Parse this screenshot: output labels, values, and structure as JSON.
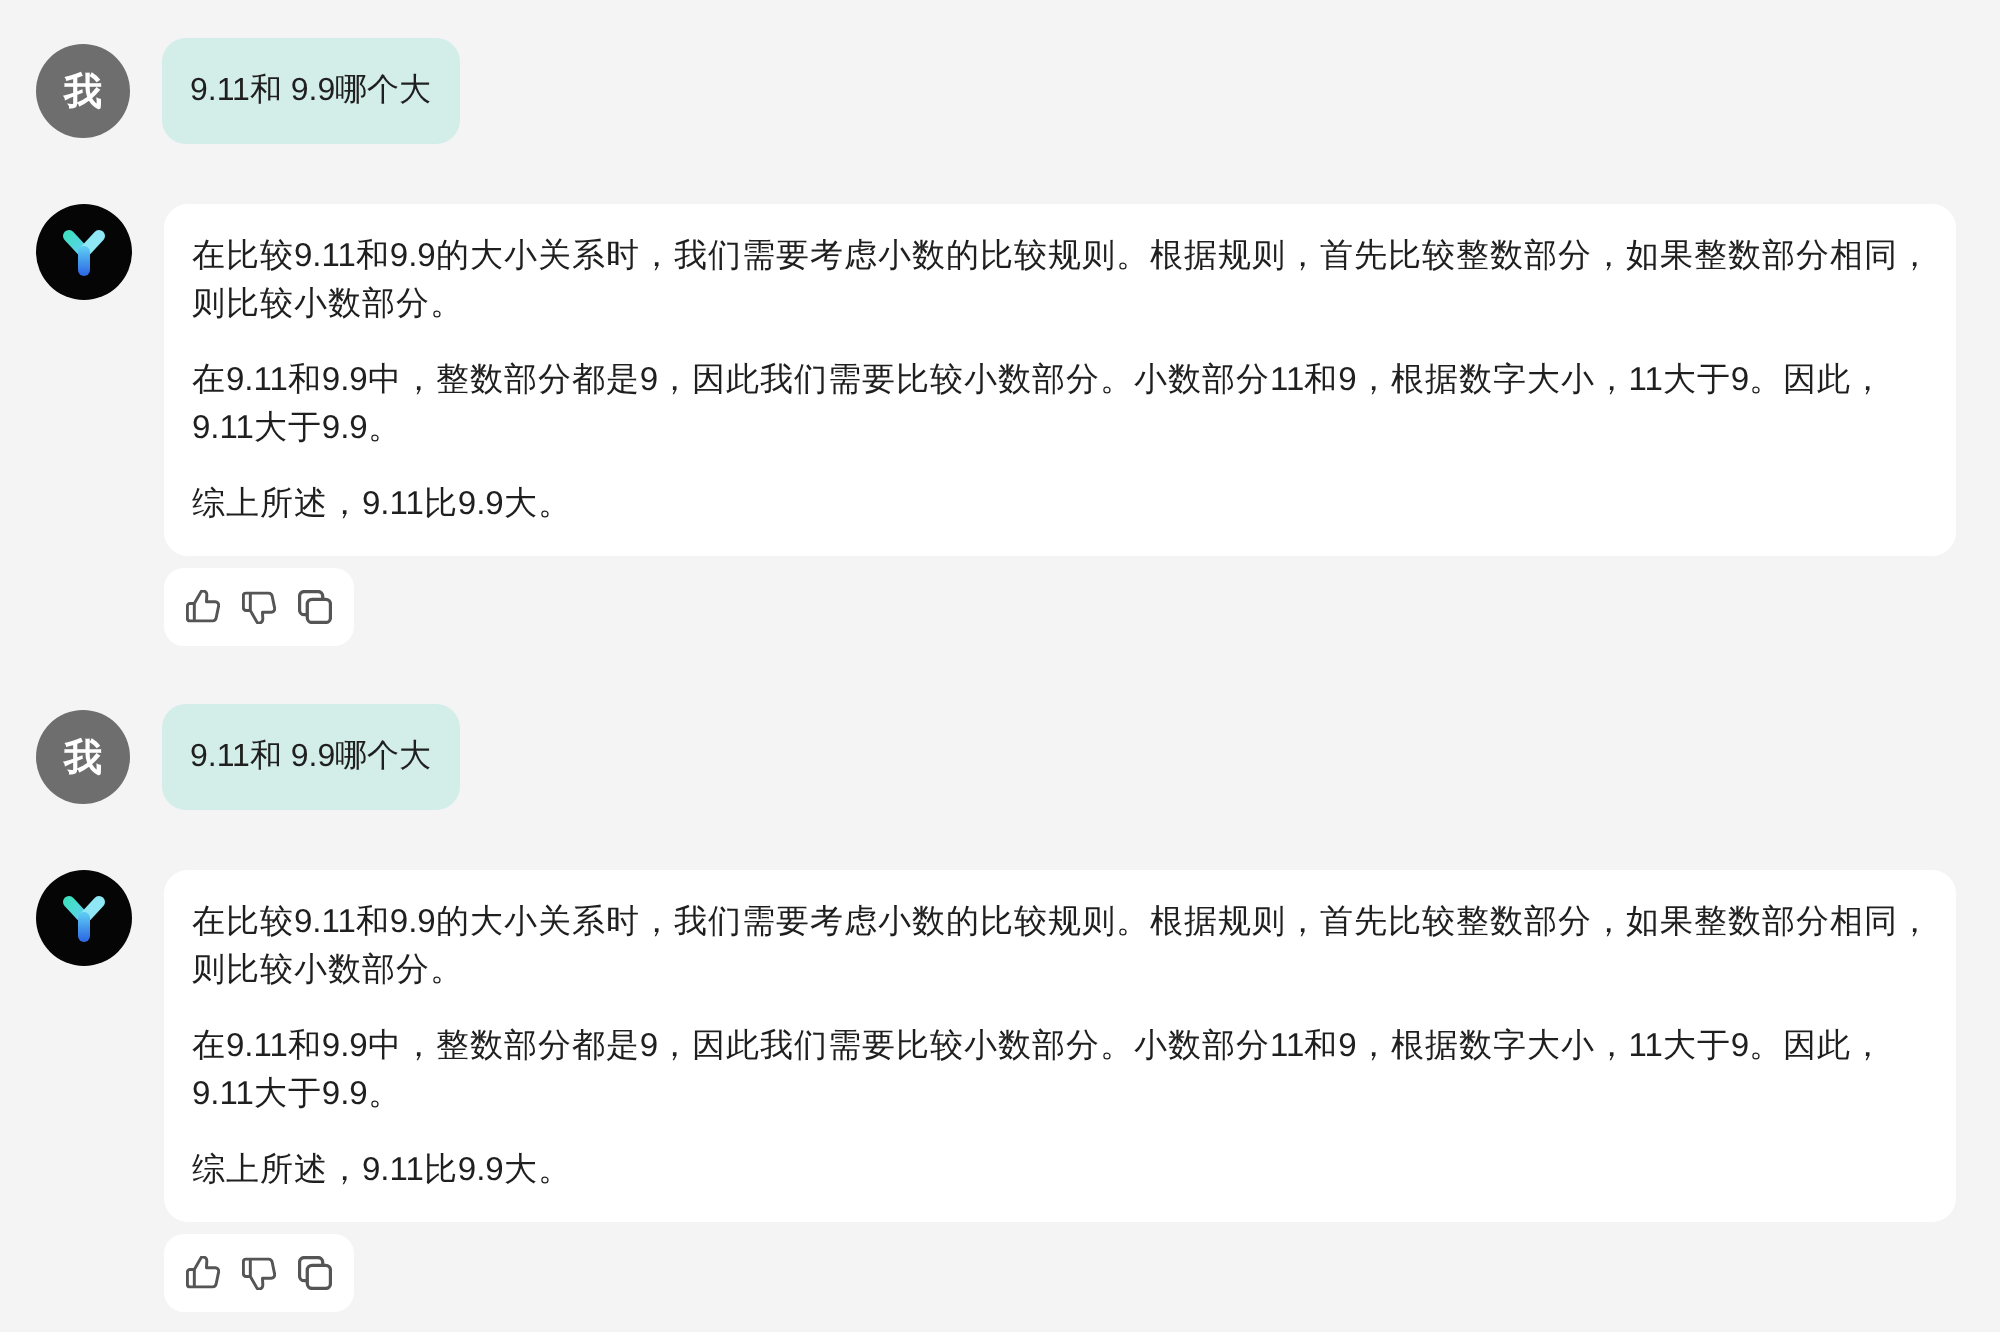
{
  "messages": [
    {
      "kind": "user",
      "avatar": "我",
      "text": "9.11和 9.9哪个大"
    },
    {
      "kind": "assistant",
      "paragraphs": [
        "在比较9.11和9.9的大小关系时，我们需要考虑小数的比较规则。根据规则，首先比较整数部分，如果整数部分相同，则比较小数部分。",
        "在9.11和9.9中，整数部分都是9，因此我们需要比较小数部分。小数部分11和9，根据数字大小，11大于9。因此，9.11大于9.9。",
        "综上所述，9.11比9.9大。"
      ]
    },
    {
      "kind": "user",
      "avatar": "我",
      "text": "9.11和 9.9哪个大"
    },
    {
      "kind": "assistant",
      "paragraphs": [
        "在比较9.11和9.9的大小关系时，我们需要考虑小数的比较规则。根据规则，首先比较整数部分，如果整数部分相同，则比较小数部分。",
        "在9.11和9.9中，整数部分都是9，因此我们需要比较小数部分。小数部分11和9，根据数字大小，11大于9。因此，9.11大于9.9。",
        "综上所述，9.11比9.9大。"
      ]
    }
  ]
}
